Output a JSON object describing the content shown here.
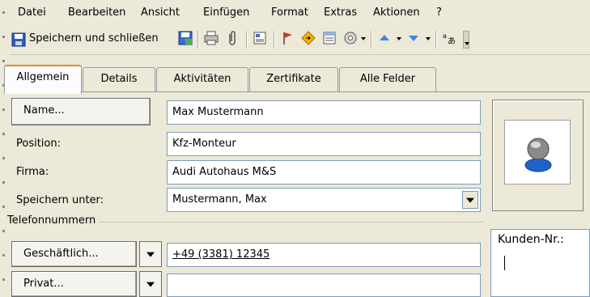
{
  "menubar": {
    "items": [
      "Datei",
      "Bearbeiten",
      "Ansicht",
      "Einfügen",
      "Format",
      "Extras",
      "Aktionen",
      "?"
    ]
  },
  "toolbar": {
    "save_close_label": "Speichern und schließen"
  },
  "tabs": [
    {
      "label": "Allgemein"
    },
    {
      "label": "Details"
    },
    {
      "label": "Aktivitäten"
    },
    {
      "label": "Zertifikate"
    },
    {
      "label": "Alle Felder"
    }
  ],
  "general": {
    "name_button": "Name...",
    "name_value": "Max Mustermann",
    "position_label": "Position:",
    "position_value": "Kfz-Monteur",
    "company_label": "Firma:",
    "company_value": "Audi Autohaus M&S",
    "save_as_label": "Speichern unter:",
    "save_as_value": "Mustermann, Max"
  },
  "phones": {
    "group_label": "Telefonnummern",
    "business_button": "Geschäftlich...",
    "business_value": "+49 (3381) 12345",
    "private_button": "Privat...",
    "private_value": ""
  },
  "notes": {
    "text": "Kunden-Nr.:"
  },
  "colors": {
    "tab_accent": "#e68b2c",
    "field_border": "#7f9db9"
  }
}
